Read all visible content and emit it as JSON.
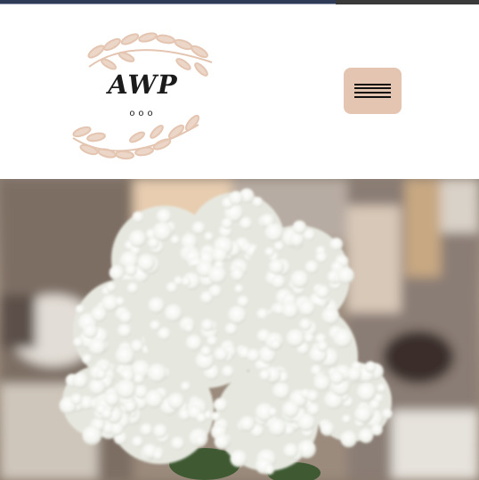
{
  "progress": {
    "fraction": 0.7
  },
  "logo": {
    "text": "AWP",
    "dots": "ooo",
    "accent_color": "#e4c5b1"
  },
  "header": {
    "menu_icon": "hamburger-icon",
    "menu_button_color": "#e4c5b1"
  },
  "hero": {
    "subject": "white-hydrangea-centerpiece"
  }
}
